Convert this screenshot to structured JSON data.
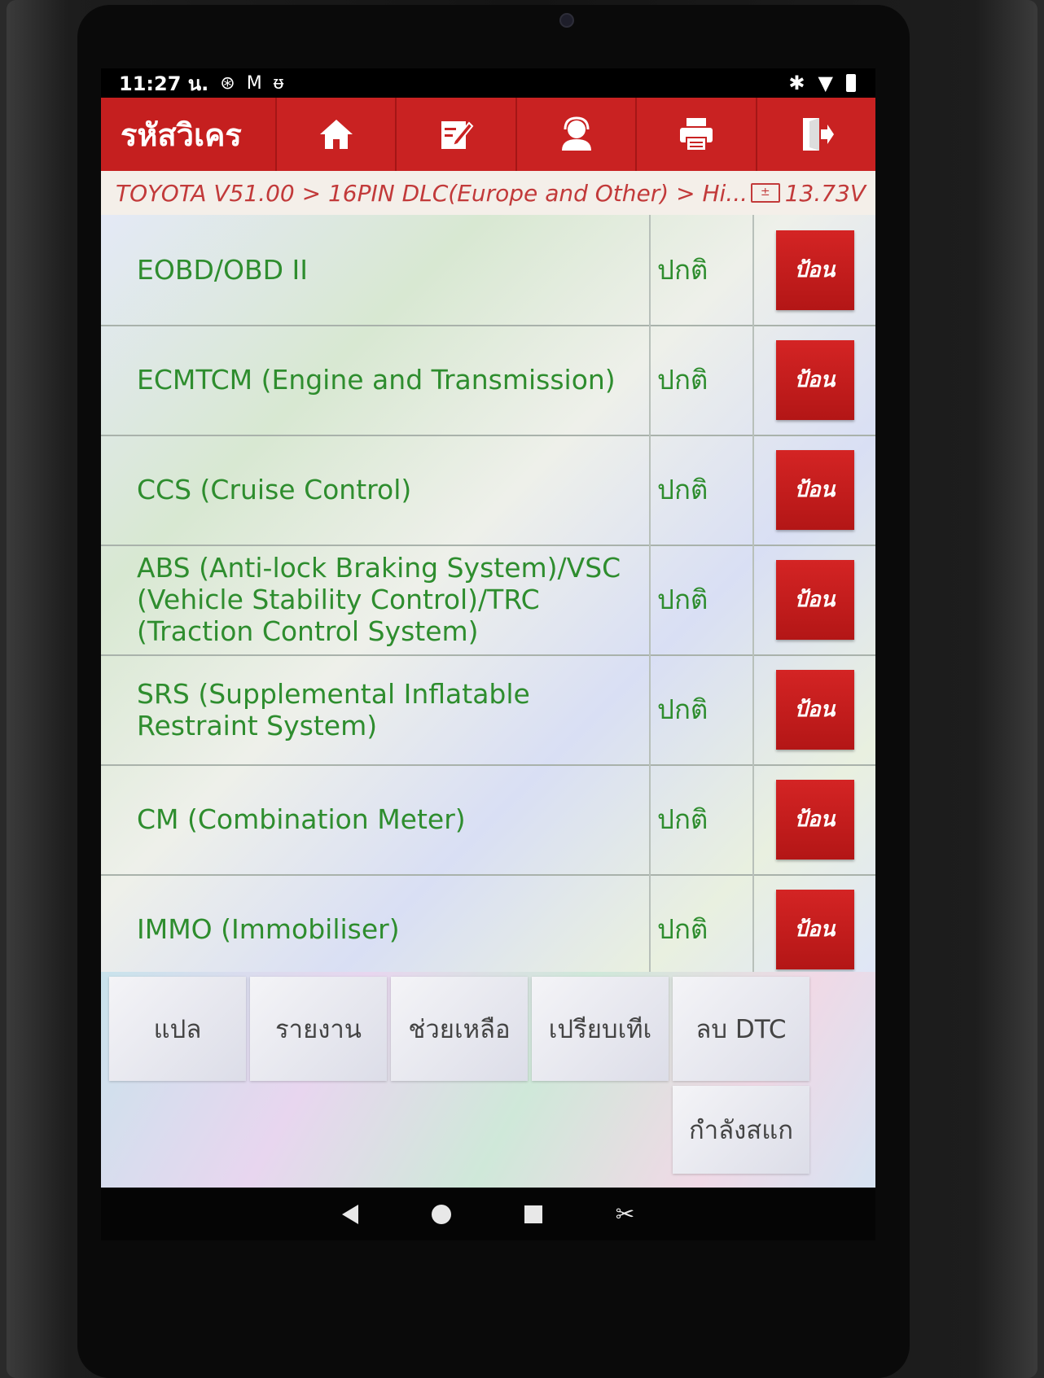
{
  "status_bar": {
    "time": "11:27 น.",
    "icons": [
      "sync-icon",
      "gmail-icon",
      "diagnostic-icon"
    ],
    "right_icons": [
      "bluetooth-icon",
      "wifi-icon",
      "battery-icon"
    ]
  },
  "header": {
    "title": "รหัสวิเคร",
    "buttons": [
      "home-icon",
      "edit-icon",
      "user-support-icon",
      "print-icon",
      "exit-icon"
    ]
  },
  "breadcrumb": {
    "path": "TOYOTA V51.00 > 16PIN DLC(Europe and Other) > Hi...",
    "voltage": "13.73V"
  },
  "systems": [
    {
      "name": "EOBD/OBD II",
      "status": "ปกติ",
      "button": "ป้อน"
    },
    {
      "name": "ECMTCM (Engine and Transmission)",
      "status": "ปกติ",
      "button": "ป้อน"
    },
    {
      "name": "CCS (Cruise Control)",
      "status": "ปกติ",
      "button": "ป้อน"
    },
    {
      "name": "ABS (Anti-lock Braking System)/VSC (Vehicle Stability Control)/TRC (Traction Control System)",
      "status": "ปกติ",
      "button": "ป้อน"
    },
    {
      "name": "SRS (Supplemental Inflatable Restraint System)",
      "status": "ปกติ",
      "button": "ป้อน"
    },
    {
      "name": "CM (Combination Meter)",
      "status": "ปกติ",
      "button": "ป้อน"
    },
    {
      "name": "IMMO (Immobiliser)",
      "status": "ปกติ",
      "button": "ป้อน"
    }
  ],
  "function_buttons": {
    "translate": "แปล",
    "report": "รายงาน",
    "help": "ช่วยเหลือ",
    "compare": "เปรียบเทีเ",
    "clear_dtc": "ลบ DTC",
    "scanning": "กำลังสแก"
  },
  "colors": {
    "header_red": "#c51f1f",
    "system_green": "#2e8d2e",
    "breadcrumb_red": "#c23a3a"
  }
}
